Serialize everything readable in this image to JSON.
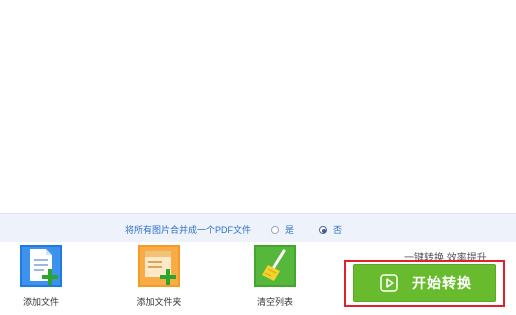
{
  "merge_option": {
    "label": "将所有图片合并成一个PDF文件",
    "options": [
      {
        "label": "是",
        "checked": false
      },
      {
        "label": "否",
        "checked": true
      }
    ]
  },
  "toolbar": {
    "add_file_label": "添加文件",
    "add_folder_label": "添加文件夹",
    "clear_list_label": "清空列表"
  },
  "slogan": "一键转换  效率提升",
  "start_button": {
    "label": "开始转换"
  },
  "colors": {
    "accent_blue": "#2f6fc7",
    "start_green": "#67bb2d",
    "highlight_red": "#e0212b"
  },
  "icons": {
    "add_file": "document-add-icon",
    "add_folder": "folder-add-icon",
    "clear_list": "broom-icon",
    "start": "play-icon"
  }
}
